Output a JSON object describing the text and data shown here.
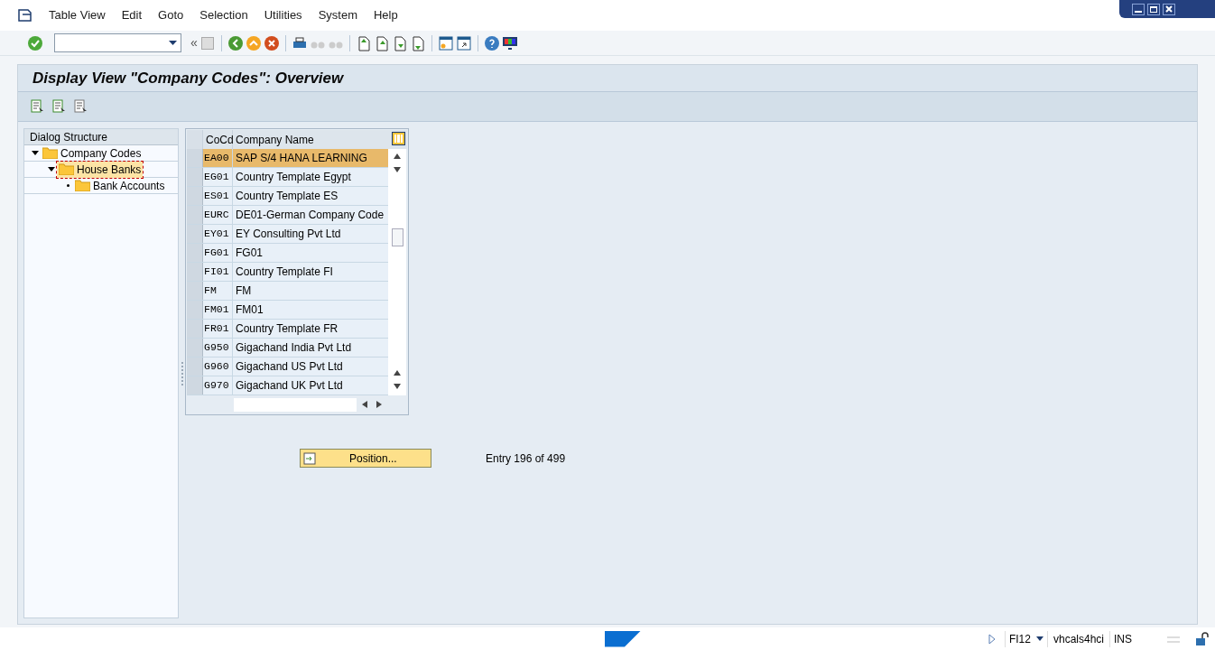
{
  "menu": [
    "Table View",
    "Edit",
    "Goto",
    "Selection",
    "Utilities",
    "System",
    "Help"
  ],
  "toolbar": {
    "history_mark": "«"
  },
  "title": "Display View \"Company Codes\": Overview",
  "tree": {
    "header": "Dialog Structure",
    "items": [
      {
        "label": "Company Codes",
        "expanded": true,
        "selected": false,
        "children": [
          {
            "label": "House Banks",
            "expanded": true,
            "selected": true,
            "children": [
              {
                "label": "Bank Accounts",
                "selected": false
              }
            ]
          }
        ]
      }
    ]
  },
  "table": {
    "columns": [
      "CoCd",
      "Company Name"
    ],
    "rows": [
      {
        "cells": [
          "EA00",
          "SAP S/4 HANA LEARNING"
        ],
        "selected": true
      },
      {
        "cells": [
          "EG01",
          "Country Template Egypt"
        ],
        "selected": false
      },
      {
        "cells": [
          "ES01",
          "Country Template ES"
        ],
        "selected": false
      },
      {
        "cells": [
          "EURC",
          "DE01-German Company Code"
        ],
        "selected": false
      },
      {
        "cells": [
          "EY01",
          "EY Consulting Pvt Ltd"
        ],
        "selected": false
      },
      {
        "cells": [
          "FG01",
          "FG01"
        ],
        "selected": false
      },
      {
        "cells": [
          "FI01",
          "Country Template FI"
        ],
        "selected": false
      },
      {
        "cells": [
          "FM",
          "FM"
        ],
        "selected": false
      },
      {
        "cells": [
          "FM01",
          "FM01"
        ],
        "selected": false
      },
      {
        "cells": [
          "FR01",
          "Country Template FR"
        ],
        "selected": false
      },
      {
        "cells": [
          "G950",
          "Gigachand India Pvt Ltd"
        ],
        "selected": false
      },
      {
        "cells": [
          "G960",
          "Gigachand US Pvt Ltd"
        ],
        "selected": false
      },
      {
        "cells": [
          "G970",
          "Gigachand UK Pvt Ltd"
        ],
        "selected": false
      }
    ]
  },
  "position_button": "Position...",
  "entry_info": "Entry 196 of 499",
  "status_bar": {
    "transaction": "FI12",
    "server": "vhcals4hci",
    "mode": "INS"
  }
}
